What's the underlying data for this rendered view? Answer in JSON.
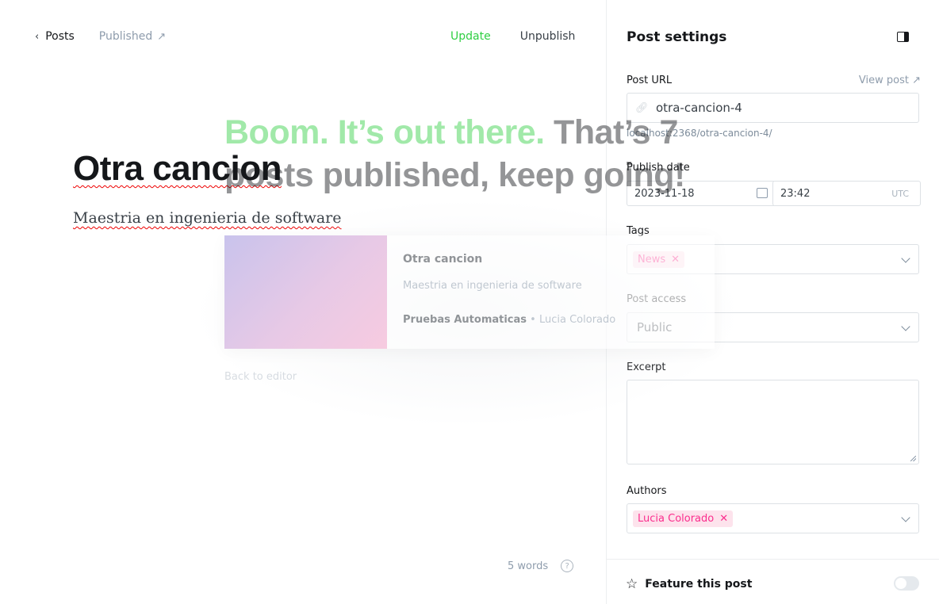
{
  "editor": {
    "back_label": "Posts",
    "status_label": "Published",
    "update_label": "Update",
    "unpublish_label": "Unpublish",
    "title": "Otra cancion",
    "excerpt": "Maestria en ingenieria de software",
    "word_count": "5 words",
    "help_label": "?"
  },
  "publish_overlay": {
    "headline_green": "Boom. It’s out there.",
    "headline_grey": "That’s 7 posts published, keep going!",
    "card_title": "Otra cancion",
    "card_excerpt": "Maestria en ingenieria de software",
    "card_site": "Pruebas Automaticas",
    "card_author": "Lucia Colorado",
    "back_to_editor": "Back to editor"
  },
  "settings": {
    "header": "Post settings",
    "post_url_label": "Post URL",
    "view_post_label": "View post",
    "post_url_value": "otra-cancion-4",
    "post_url_hint": "localhost:2368/otra-cancion-4/",
    "publish_date_label": "Publish date",
    "publish_date_value": "2023-11-18",
    "publish_time_value": "23:42",
    "timezone": "UTC",
    "tags_label": "Tags",
    "tags": [
      "News"
    ],
    "access_label": "Post access",
    "access_value": "Public",
    "excerpt_label": "Excerpt",
    "excerpt_value": "",
    "authors_label": "Authors",
    "authors": [
      "Lucia Colorado"
    ],
    "feature_label": "Feature this post",
    "feature_enabled": false
  },
  "colors": {
    "accent_green": "#30cf43",
    "token_bg": "#fde3ec",
    "token_text": "#fb2d8d"
  }
}
